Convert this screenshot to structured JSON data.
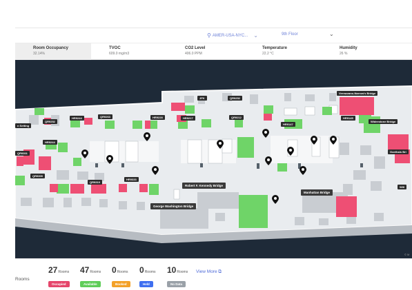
{
  "header": {
    "location": "AMER-USA-NYC...",
    "floor": "9th Floor"
  },
  "metrics": [
    {
      "title": "Room Occupancy",
      "value": "32.14%"
    },
    {
      "title": "TVOC",
      "value": "609.0 mg/m3"
    },
    {
      "title": "CO2 Level",
      "value": "406.0 PPM"
    },
    {
      "title": "Temperature",
      "value": "22.2 °C"
    },
    {
      "title": "Humidity",
      "value": "26 %"
    }
  ],
  "map": {
    "room_labels": [
      "JFK",
      "QR9252",
      "QR9252",
      "HR9244",
      "QR9263",
      "HR9228",
      "HR9217",
      "QR9212",
      "HR9147",
      "HR9145",
      "HR9244",
      "QR9301",
      "QR9309",
      "QR9319",
      "HR9333",
      "n Setting",
      "Verrazzano-Narrow's Bridge",
      "Wideestone Bridge",
      "Goethals Bri",
      "Will"
    ],
    "bridge_labels": [
      "Robert F. Kennedy Bridge",
      "George Washington Bridge",
      "Manhattan Bridge"
    ],
    "copyright": "© M"
  },
  "footer": {
    "rooms_label": "Rooms",
    "unit": "Rooms",
    "stats": [
      {
        "count": "27",
        "label": "Occupied",
        "color": "#e5466b"
      },
      {
        "count": "47",
        "label": "Available",
        "color": "#5fcd59"
      },
      {
        "count": "0",
        "label": "Booked",
        "color": "#f3a128"
      },
      {
        "count": "0",
        "label": "Held",
        "color": "#3f6ff0"
      },
      {
        "count": "10",
        "label": "No Data",
        "color": "#9aa1a8"
      }
    ],
    "view_more": "View More ⧉"
  }
}
